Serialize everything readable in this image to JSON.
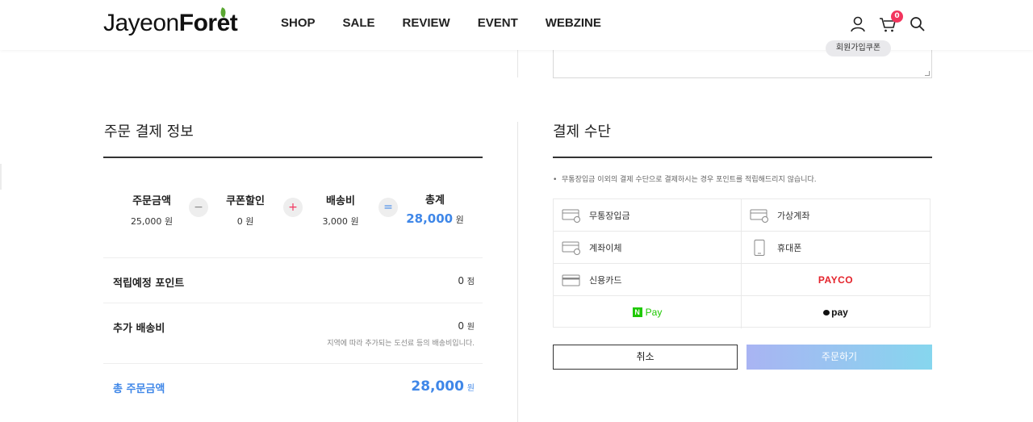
{
  "header": {
    "logo_part1": "Jayeon",
    "logo_part2": "Foret",
    "nav": [
      "SHOP",
      "SALE",
      "REVIEW",
      "EVENT",
      "WEBZINE"
    ],
    "cart_count": "0",
    "coupon_tooltip": "회원가입쿠폰",
    "icons": [
      "user-icon",
      "cart-icon",
      "search-icon"
    ]
  },
  "order_summary": {
    "title": "주문 결제 정보",
    "items": [
      {
        "label": "주문금액",
        "amount": "25,000",
        "unit": "원"
      },
      {
        "label": "쿠폰할인",
        "amount": "0",
        "unit": "원"
      },
      {
        "label": "배송비",
        "amount": "3,000",
        "unit": "원"
      },
      {
        "label": "총계",
        "amount": "28,000",
        "unit": "원"
      }
    ],
    "operators": [
      "−",
      "+",
      "="
    ],
    "points_label": "적립예정 포인트",
    "points_value": "0",
    "points_unit": "점",
    "extra_shipping_label": "추가 배송비",
    "extra_shipping_value": "0",
    "extra_shipping_unit": "원",
    "extra_shipping_note": "지역에 따라 추가되는 도선료 등의 배송비입니다.",
    "total_label": "총 주문금액",
    "total_value": "28,000",
    "total_unit": "원"
  },
  "payment": {
    "title": "결제 수단",
    "note": "무통장입금 이외의 결제 수단으로 결제하시는 경우 포인트를 적립해드리지 않습니다.",
    "methods": {
      "bank_deposit": "무통장입금",
      "virtual_account": "가상계좌",
      "transfer": "계좌이체",
      "phone": "휴대폰",
      "card": "신용카드",
      "payco": "PAYCO",
      "npay_n": "N",
      "npay": "Pay",
      "kakaopay": "pay"
    },
    "cancel_label": "취소",
    "order_label": "주문하기"
  },
  "colors": {
    "accent_blue": "#3f87e8",
    "badge_pink": "#f2345d",
    "payco_red": "#e4232b",
    "npay_green": "#1ec800",
    "order_gradient_start": "#a9b4f3",
    "order_gradient_end": "#86d6ee"
  }
}
